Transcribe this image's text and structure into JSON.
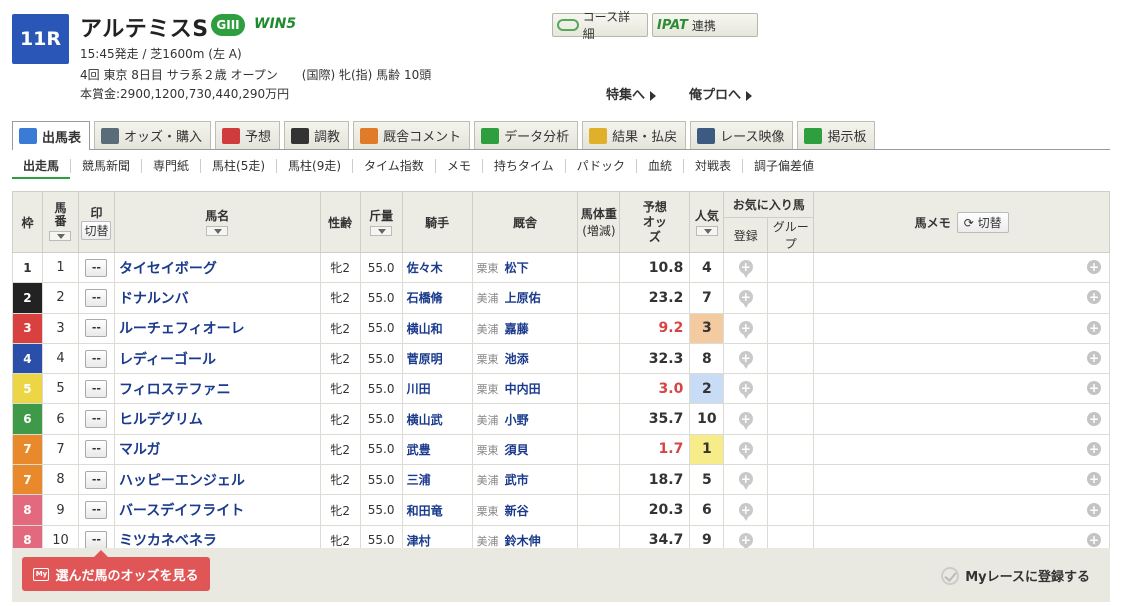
{
  "race": {
    "number": "11R",
    "title": "アルテミスS",
    "grade": "GIII",
    "win5": "WIN5",
    "line1": "15:45発走 / 芝1600m (左 A)",
    "line2": "4回 東京 8日目 サラ系２歳 オープン　　(国際) 牝(指) 馬齢 10頭",
    "line3": "本賞金:2900,1200,730,440,290万円"
  },
  "top_buttons": {
    "course": "コース詳細",
    "ipat_logo": "IPAT",
    "ipat_label": "連携",
    "feature": "特集へ",
    "blog": "俺プロへ"
  },
  "main_tabs": [
    {
      "label": "出馬表",
      "color": "#3a7bd5"
    },
    {
      "label": "オッズ・購入",
      "color": "#5a6b7a"
    },
    {
      "label": "予想",
      "color": "#d03b3b"
    },
    {
      "label": "調教",
      "color": "#333333"
    },
    {
      "label": "厩舎コメント",
      "color": "#e07b2a"
    },
    {
      "label": "データ分析",
      "color": "#2e9e3f"
    },
    {
      "label": "結果・払戻",
      "color": "#e0b02a"
    },
    {
      "label": "レース映像",
      "color": "#3d5a80"
    },
    {
      "label": "掲示板",
      "color": "#2e9e3f"
    }
  ],
  "sub_tabs": [
    "出走馬",
    "競馬新聞",
    "専門紙",
    "馬柱(5走)",
    "馬柱(9走)",
    "タイム指数",
    "メモ",
    "持ちタイム",
    "パドック",
    "血統",
    "対戦表",
    "調子偏差値"
  ],
  "table_headers": {
    "waku": "枠",
    "umaban": "馬番",
    "mark": "印",
    "mark_toggle": "切替",
    "name": "馬名",
    "sex_age": "性齢",
    "weight": "斤量",
    "jockey": "騎手",
    "stable": "厩舎",
    "body_weight": "馬体重",
    "body_diff": "(増減)",
    "odds": "予想オッズ",
    "popular": "人気",
    "favorite": "お気に入り馬",
    "fav_register": "登録",
    "fav_group": "グループ",
    "memo": "馬メモ",
    "memo_toggle": "切替"
  },
  "horses": [
    {
      "waku": "1",
      "waku_bg": "#ffffff",
      "waku_fg": "#333333",
      "num": "1",
      "mark": "--",
      "name": "タイセイボーグ",
      "sex_age": "牝2",
      "weight": "55.0",
      "jockey": "佐々木",
      "area": "栗東",
      "trainer": "松下",
      "odds": "10.8",
      "hot": false,
      "pop": "4",
      "pop_bg": "#ffffff"
    },
    {
      "waku": "2",
      "waku_bg": "#222222",
      "waku_fg": "#ffffff",
      "num": "2",
      "mark": "--",
      "name": "ドナルンバ",
      "sex_age": "牝2",
      "weight": "55.0",
      "jockey": "石橋脩",
      "area": "美浦",
      "trainer": "上原佑",
      "odds": "23.2",
      "hot": false,
      "pop": "7",
      "pop_bg": "#ffffff"
    },
    {
      "waku": "3",
      "waku_bg": "#d94141",
      "waku_fg": "#ffffff",
      "num": "3",
      "mark": "--",
      "name": "ルーチェフィオーレ",
      "sex_age": "牝2",
      "weight": "55.0",
      "jockey": "横山和",
      "area": "美浦",
      "trainer": "嘉藤",
      "odds": "9.2",
      "hot": true,
      "pop": "3",
      "pop_bg": "#f4caa0"
    },
    {
      "waku": "4",
      "waku_bg": "#2a4fa8",
      "waku_fg": "#ffffff",
      "num": "4",
      "mark": "--",
      "name": "レディーゴール",
      "sex_age": "牝2",
      "weight": "55.0",
      "jockey": "菅原明",
      "area": "栗東",
      "trainer": "池添",
      "odds": "32.3",
      "hot": false,
      "pop": "8",
      "pop_bg": "#ffffff"
    },
    {
      "waku": "5",
      "waku_bg": "#ecd645",
      "waku_fg": "#ffffff",
      "num": "5",
      "mark": "--",
      "name": "フィロステファニ",
      "sex_age": "牝2",
      "weight": "55.0",
      "jockey": "川田",
      "area": "栗東",
      "trainer": "中内田",
      "odds": "3.0",
      "hot": true,
      "pop": "2",
      "pop_bg": "#c9dcf5"
    },
    {
      "waku": "6",
      "waku_bg": "#3e9a48",
      "waku_fg": "#ffffff",
      "num": "6",
      "mark": "--",
      "name": "ヒルデグリム",
      "sex_age": "牝2",
      "weight": "55.0",
      "jockey": "横山武",
      "area": "美浦",
      "trainer": "小野",
      "odds": "35.7",
      "hot": false,
      "pop": "10",
      "pop_bg": "#ffffff"
    },
    {
      "waku": "7",
      "waku_bg": "#e88a2b",
      "waku_fg": "#ffffff",
      "num": "7",
      "mark": "--",
      "name": "マルガ",
      "sex_age": "牝2",
      "weight": "55.0",
      "jockey": "武豊",
      "area": "栗東",
      "trainer": "須貝",
      "odds": "1.7",
      "hot": true,
      "pop": "1",
      "pop_bg": "#f7ec8a"
    },
    {
      "waku": "7",
      "waku_bg": "#e88a2b",
      "waku_fg": "#ffffff",
      "num": "8",
      "mark": "--",
      "name": "ハッピーエンジェル",
      "sex_age": "牝2",
      "weight": "55.0",
      "jockey": "三浦",
      "area": "美浦",
      "trainer": "武市",
      "odds": "18.7",
      "hot": false,
      "pop": "5",
      "pop_bg": "#ffffff"
    },
    {
      "waku": "8",
      "waku_bg": "#e36a7e",
      "waku_fg": "#ffffff",
      "num": "9",
      "mark": "--",
      "name": "バースデイフライト",
      "sex_age": "牝2",
      "weight": "55.0",
      "jockey": "和田竜",
      "area": "栗東",
      "trainer": "新谷",
      "odds": "20.3",
      "hot": false,
      "pop": "6",
      "pop_bg": "#ffffff"
    },
    {
      "waku": "8",
      "waku_bg": "#e36a7e",
      "waku_fg": "#ffffff",
      "num": "10",
      "mark": "--",
      "name": "ミツカネベネラ",
      "sex_age": "牝2",
      "weight": "55.0",
      "jockey": "津村",
      "area": "美浦",
      "trainer": "鈴木伸",
      "odds": "34.7",
      "hot": false,
      "pop": "9",
      "pop_bg": "#ffffff"
    }
  ],
  "footer": {
    "odds_button": "選んだ馬のオッズを見る",
    "my_icon": "My",
    "my_race": "Myレースに登録する"
  }
}
